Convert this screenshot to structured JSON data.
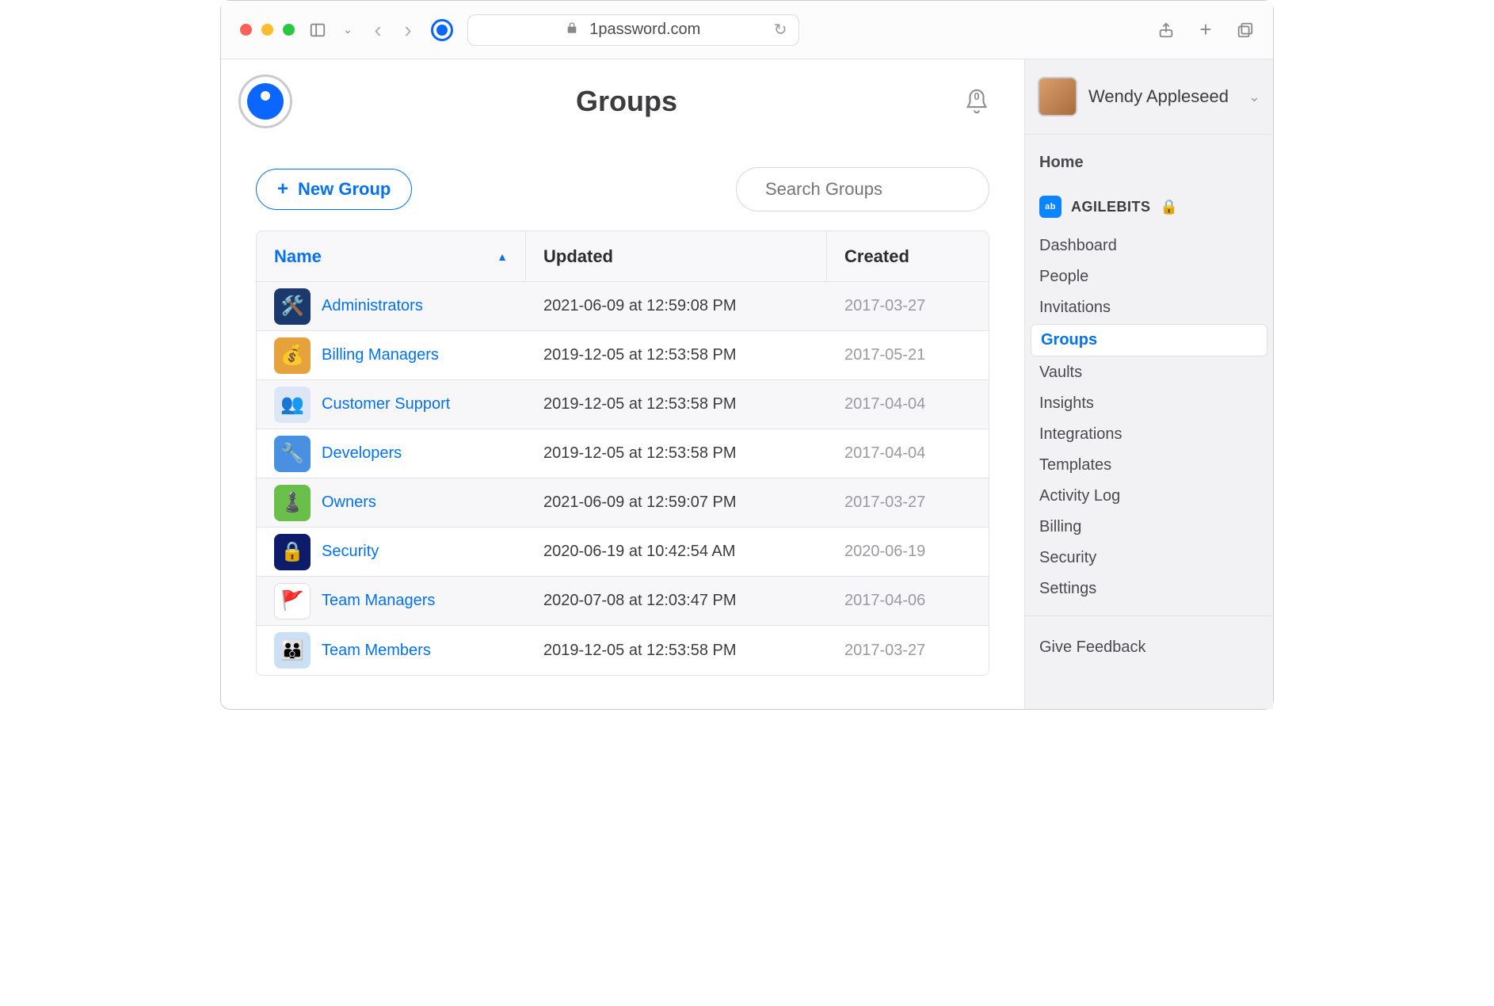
{
  "browser": {
    "url_display": "1password.com"
  },
  "header": {
    "title": "Groups",
    "notification_count": "0"
  },
  "toolbar": {
    "new_group_label": "New Group",
    "search_placeholder": "Search Groups"
  },
  "table": {
    "columns": {
      "name": "Name",
      "updated": "Updated",
      "created": "Created"
    },
    "rows": [
      {
        "name": "Administrators",
        "updated": "2021-06-09 at 12:59:08 PM",
        "created": "2017-03-27",
        "icon_class": "i-admin",
        "emoji": "🛠️"
      },
      {
        "name": "Billing Managers",
        "updated": "2019-12-05 at 12:53:58 PM",
        "created": "2017-05-21",
        "icon_class": "i-billing",
        "emoji": "💰"
      },
      {
        "name": "Customer Support",
        "updated": "2019-12-05 at 12:53:58 PM",
        "created": "2017-04-04",
        "icon_class": "i-support",
        "emoji": "👥"
      },
      {
        "name": "Developers",
        "updated": "2019-12-05 at 12:53:58 PM",
        "created": "2017-04-04",
        "icon_class": "i-dev",
        "emoji": "🔧"
      },
      {
        "name": "Owners",
        "updated": "2021-06-09 at 12:59:07 PM",
        "created": "2017-03-27",
        "icon_class": "i-owners",
        "emoji": "♟️"
      },
      {
        "name": "Security",
        "updated": "2020-06-19 at 10:42:54 AM",
        "created": "2020-06-19",
        "icon_class": "i-security",
        "emoji": "🔒"
      },
      {
        "name": "Team Managers",
        "updated": "2020-07-08 at 12:03:47 PM",
        "created": "2017-04-06",
        "icon_class": "i-tm",
        "emoji": "🚩"
      },
      {
        "name": "Team Members",
        "updated": "2019-12-05 at 12:53:58 PM",
        "created": "2017-03-27",
        "icon_class": "i-team",
        "emoji": "👪"
      }
    ]
  },
  "sidebar": {
    "user_name": "Wendy Appleseed",
    "home_label": "Home",
    "company_label": "AGILEBITS",
    "company_icon_text": "agile bits",
    "lock_emoji": "🔒",
    "items": [
      "Dashboard",
      "People",
      "Invitations",
      "Groups",
      "Vaults",
      "Insights",
      "Integrations",
      "Templates",
      "Activity Log",
      "Billing",
      "Security",
      "Settings"
    ],
    "active_index": 3,
    "feedback_label": "Give Feedback"
  }
}
